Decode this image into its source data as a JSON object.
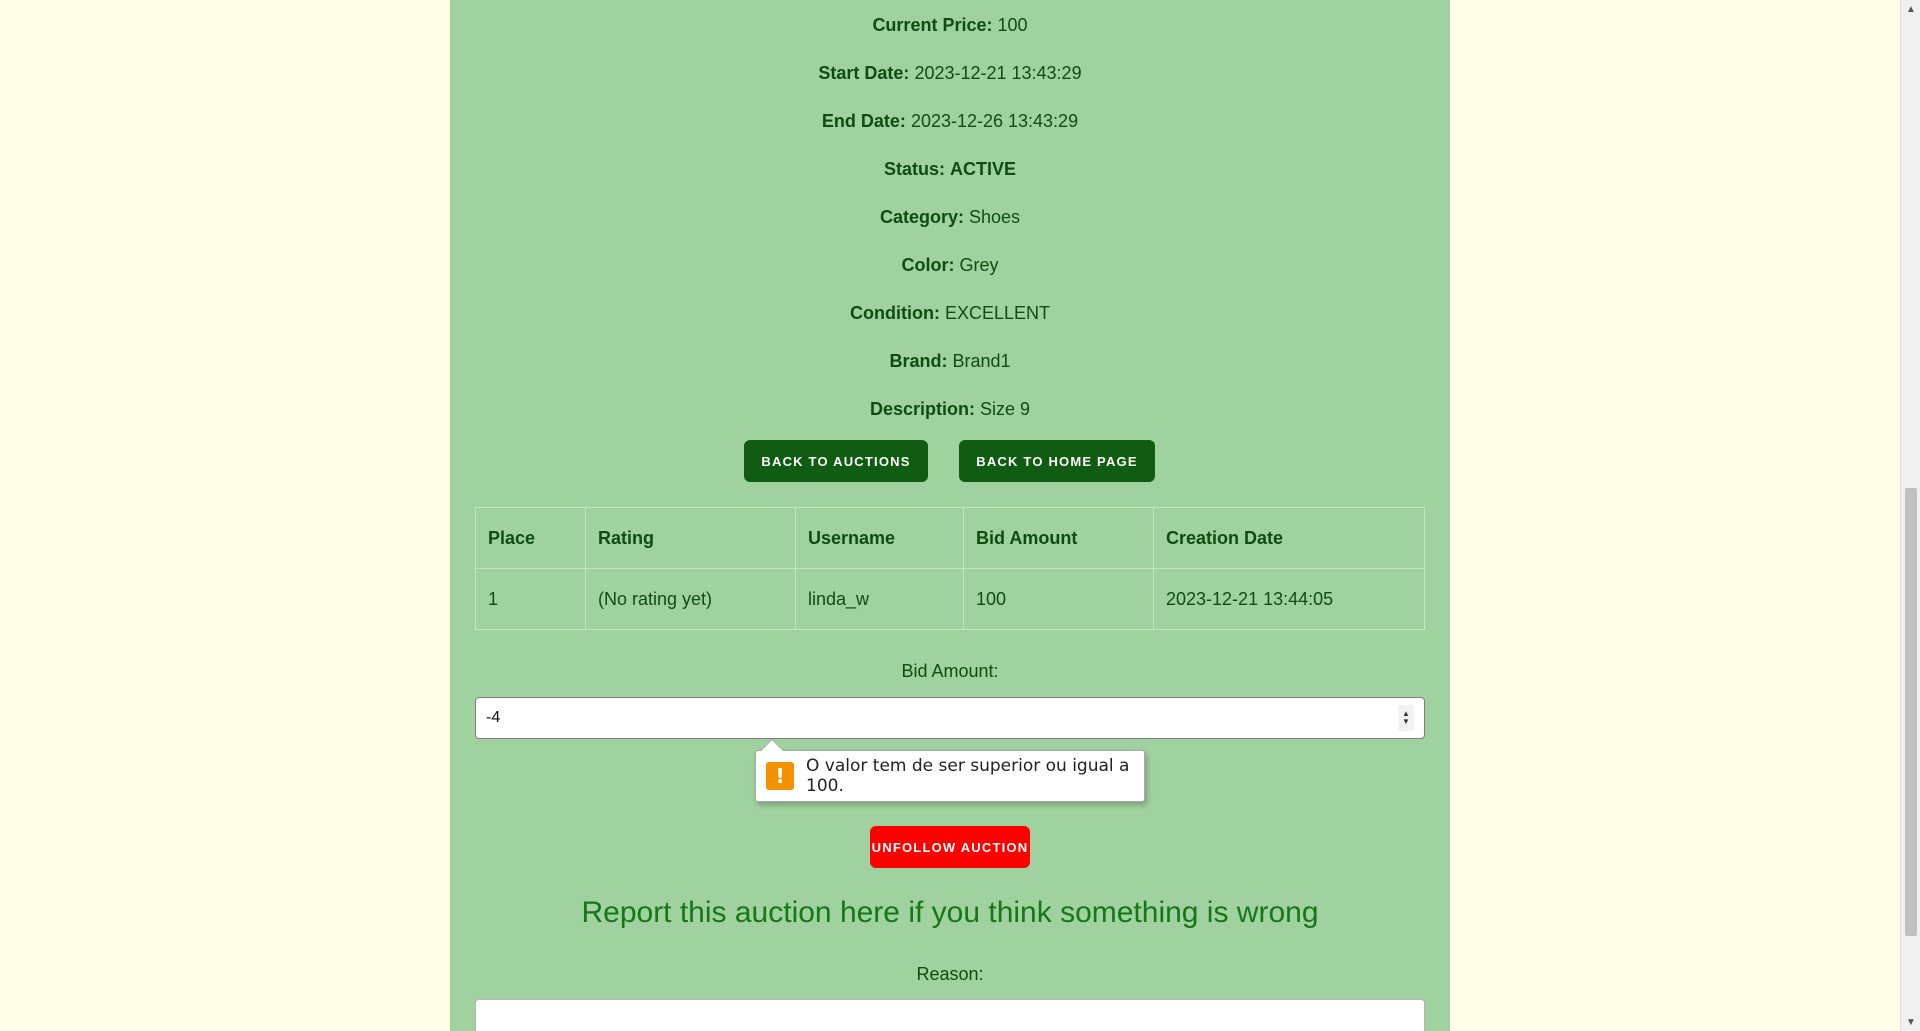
{
  "auction_details": [
    {
      "label": "Current Price:",
      "value": "100"
    },
    {
      "label": "Start Date:",
      "value": "2023-12-21 13:43:29"
    },
    {
      "label": "End Date:",
      "value": "2023-12-26 13:43:29"
    },
    {
      "label": "Status:",
      "value": "ACTIVE"
    },
    {
      "label": "Category:",
      "value": "Shoes"
    },
    {
      "label": "Color:",
      "value": "Grey"
    },
    {
      "label": "Condition:",
      "value": "EXCELLENT"
    },
    {
      "label": "Brand:",
      "value": "Brand1"
    },
    {
      "label": "Description:",
      "value": "Size 9"
    }
  ],
  "buttons": {
    "back_to_auctions": "Back to auctions",
    "back_to_home": "Back to home page",
    "unfollow": "Unfollow auction"
  },
  "bids_table": {
    "headers": [
      "Place",
      "Rating",
      "Username",
      "Bid Amount",
      "Creation Date"
    ],
    "rows": [
      [
        "1",
        "(No rating yet)",
        "linda_w",
        "100",
        "2023-12-21 13:44:05"
      ]
    ]
  },
  "bid_form": {
    "label": "Bid Amount:",
    "value": "-4",
    "validation_message": "O valor tem de ser superior ou igual a 100."
  },
  "report": {
    "heading": "Report this auction here if you think something is wrong",
    "reason_label": "Reason:"
  },
  "colors": {
    "page_background": "#fffee6",
    "panel_background": "#a0d29f",
    "primary_button": "#0f5c12",
    "danger_button": "#ff0000",
    "text": "#0f4d0f",
    "heading": "#17761a",
    "warning_icon": "#f39200"
  }
}
